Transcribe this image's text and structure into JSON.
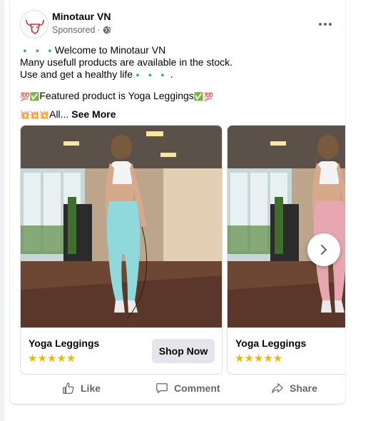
{
  "post": {
    "page_name": "Minotaur VN",
    "sponsored_label": "Sponsored",
    "sponsored_sep": "·",
    "text": {
      "line1": "Welcome to Minotaur VN",
      "line2": "Many usefull products are available in the stock.",
      "line3": "Use and get a healthy life",
      "line3_end": ".",
      "line4": "Featured product is Yoga Leggings",
      "line5": "All...",
      "see_more": "See More"
    },
    "emoji": {
      "diamond": "🔹",
      "hundred": "💯",
      "check": "✅",
      "boom": "💥"
    }
  },
  "carousel": {
    "cards": [
      {
        "title": "Yoga Leggings",
        "rating": 5,
        "stars": "★★★★★",
        "cta": "Shop Now",
        "legging_color": "#8fd8dc"
      },
      {
        "title": "Yoga Leggings",
        "rating": 5,
        "stars": "★★★★★",
        "cta": "",
        "legging_color": "#e8a7b0"
      }
    ]
  },
  "actions": {
    "like": "Like",
    "comment": "Comment",
    "share": "Share"
  },
  "colors": {
    "brand_red": "#d32f2f",
    "secondary_text": "#65676b",
    "button_bg": "#e4e6eb",
    "star": "#f5b400"
  },
  "icons": {
    "globe": "globe-icon",
    "more": "more-options-icon",
    "like": "thumbs-up-icon",
    "comment": "comment-bubble-icon",
    "share": "share-arrow-icon",
    "next": "chevron-right-icon"
  }
}
